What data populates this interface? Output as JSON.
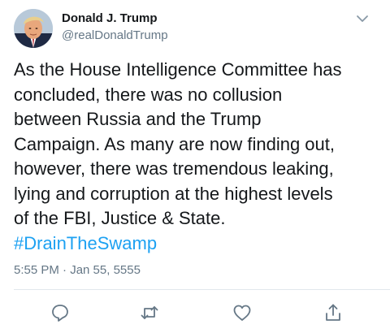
{
  "user": {
    "display_name": "Donald J. Trump",
    "handle": "@realDonaldTrump",
    "avatar_icon": "avatar-portrait"
  },
  "tweet": {
    "text": "As the House Intelligence Committee has\nconcluded, there was no collusion\nbetween Russia and the Trump\nCampaign. As many are now finding out,\nhowever, there was tremendous leaking,\nlying and corruption at the highest levels\nof the FBI, Justice & State.",
    "hashtag": "#DrainTheSwamp",
    "timestamp": "5:55 PM · Jan 55, 5555"
  },
  "actions": {
    "reply_icon": "reply-icon",
    "retweet_icon": "retweet-icon",
    "like_icon": "heart-icon",
    "share_icon": "share-icon"
  },
  "colors": {
    "text": "#14171a",
    "secondary": "#657786",
    "link": "#1da1f2",
    "divider": "#e1e8ed"
  }
}
